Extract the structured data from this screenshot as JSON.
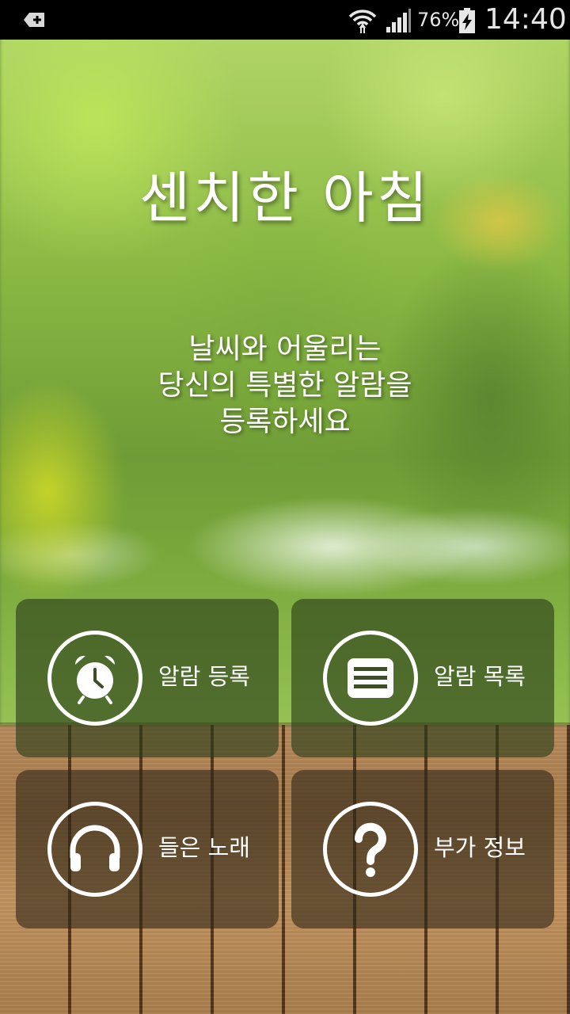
{
  "status_bar": {
    "battery_percent": "76%",
    "time": "14:40",
    "icons": [
      "add-box-icon",
      "wifi-icon",
      "signal-icon",
      "battery-charging-icon"
    ]
  },
  "app": {
    "title": "센치한 아침",
    "subtitle_lines": [
      "날씨와 어울리는",
      "당신의 특별한 알람을",
      "등록하세요"
    ]
  },
  "menu": [
    {
      "label": "알람 등록",
      "icon": "alarm-clock-icon"
    },
    {
      "label": "알람 목록",
      "icon": "list-icon"
    },
    {
      "label": "들은 노래",
      "icon": "headphones-icon"
    },
    {
      "label": "부가 정보",
      "icon": "question-mark-icon"
    }
  ]
}
